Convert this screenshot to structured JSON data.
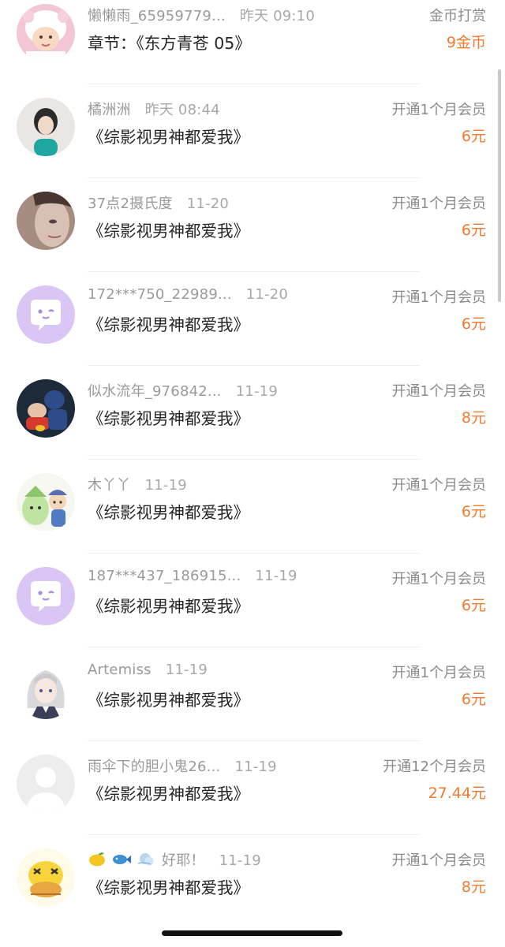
{
  "rows": [
    {
      "name": "懒懒雨_65959779...",
      "time": "昨天 09:10",
      "book": "章节：《东方青苍 05》",
      "type": "金币打赏",
      "amount": "9金币",
      "avatar": "baby-photo"
    },
    {
      "name": "橘洲洲",
      "time": "昨天 08:44",
      "book": "《综影视男神都爱我》",
      "type": "开通1个月会员",
      "amount": "6元",
      "avatar": "person-photo"
    },
    {
      "name": "37点2摄氏度",
      "time": "11-20",
      "book": "《综影视男神都爱我》",
      "type": "开通1个月会员",
      "amount": "6元",
      "avatar": "face-photo"
    },
    {
      "name": "172***750_22989...",
      "time": "11-20",
      "book": "《综影视男神都爱我》",
      "type": "开通1个月会员",
      "amount": "6元",
      "avatar": "chat-bubble-default"
    },
    {
      "name": "似水流年_976842...",
      "time": "11-19",
      "book": "《综影视男神都爱我》",
      "type": "开通1个月会员",
      "amount": "8元",
      "avatar": "cartoon-photo"
    },
    {
      "name": "木丫丫",
      "time": "11-19",
      "book": "《综影视男神都爱我》",
      "type": "开通1个月会员",
      "amount": "6元",
      "avatar": "cartoon-characters"
    },
    {
      "name": "187***437_186915...",
      "time": "11-19",
      "book": "《综影视男神都爱我》",
      "type": "开通1个月会员",
      "amount": "6元",
      "avatar": "chat-bubble-default"
    },
    {
      "name": "Artemiss",
      "time": "11-19",
      "book": "《综影视男神都爱我》",
      "type": "开通1个月会员",
      "amount": "6元",
      "avatar": "anime-girl"
    },
    {
      "name": "雨伞下的胆小鬼26...",
      "time": "11-19",
      "book": "《综影视男神都爱我》",
      "type": "开通12个月会员",
      "amount": "27.44元",
      "avatar": "default-person"
    },
    {
      "name": "好耶！",
      "time": "11-19",
      "book": "《综影视男神都爱我》",
      "type": "开通1个月会员",
      "amount": "8元",
      "avatar": "lemon-cartoon",
      "name_icons": [
        "lemon-icon",
        "fish-icon",
        "wind-icon"
      ]
    }
  ],
  "colors": {
    "amount": "#f07a30",
    "chat_avatar_bg": "#d9c6f5",
    "chat_bubble": "#a98ee6"
  }
}
